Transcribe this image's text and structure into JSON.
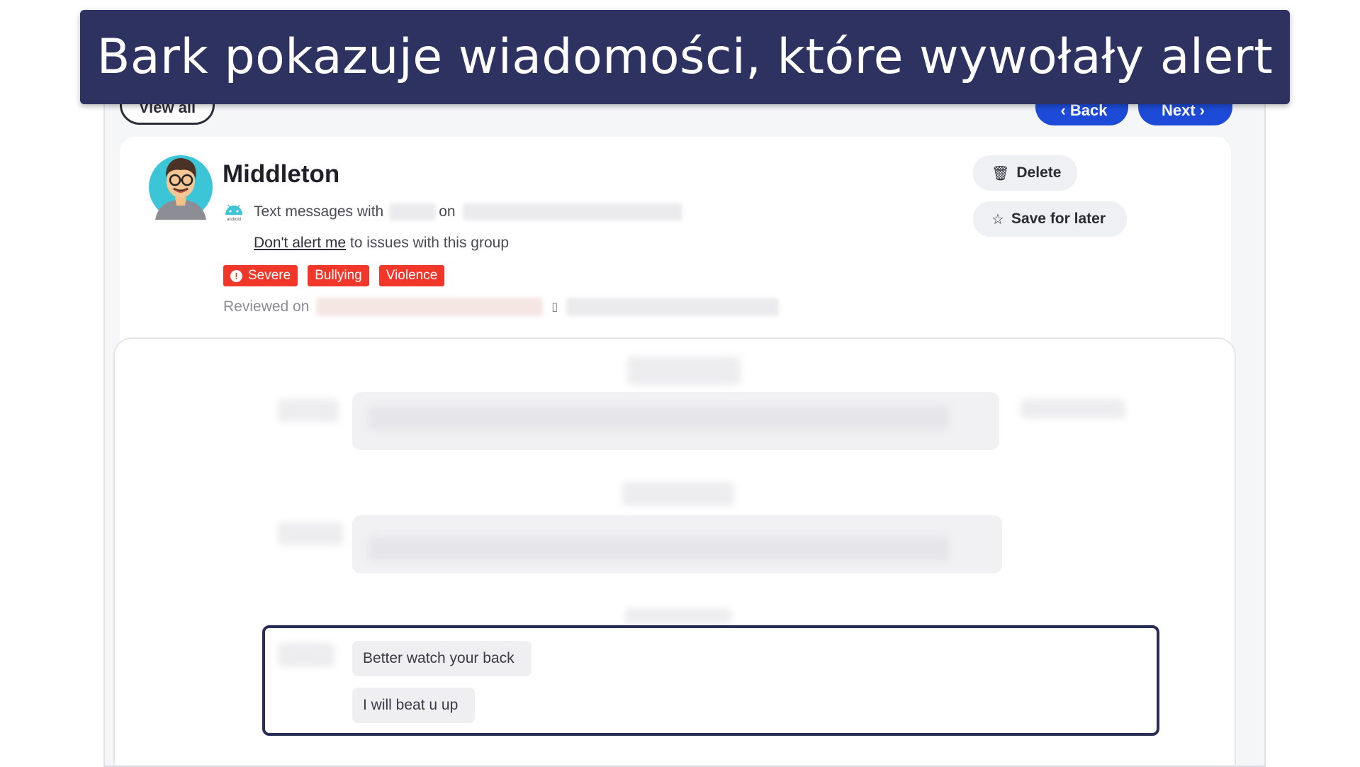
{
  "banner": {
    "title": "Bark pokazuje wiadomości, które wywołały alert"
  },
  "nav": {
    "view_all": "View all",
    "back": "Back",
    "next": "Next"
  },
  "alert": {
    "contact_name": "Middleton",
    "text_messages_prefix": "Text messages with",
    "text_messages_on": "on",
    "platform_label": "android",
    "dont_alert_link": "Don't alert me",
    "dont_alert_suffix": "to issues with this group",
    "tags": [
      {
        "label": "Severe",
        "icon": "exclamation-circle-icon"
      },
      {
        "label": "Bullying"
      },
      {
        "label": "Violence"
      }
    ],
    "reviewed_prefix": "Reviewed on"
  },
  "actions": {
    "delete": "Delete",
    "save_for_later": "Save for later"
  },
  "messages": {
    "highlighted": [
      {
        "text": "Better watch your back"
      },
      {
        "text": "I will beat u up"
      }
    ]
  },
  "colors": {
    "banner": "#2e3260",
    "primary_button": "#1d4bd8",
    "tag_red": "#f0372a",
    "highlight_border": "#2a2d55"
  }
}
